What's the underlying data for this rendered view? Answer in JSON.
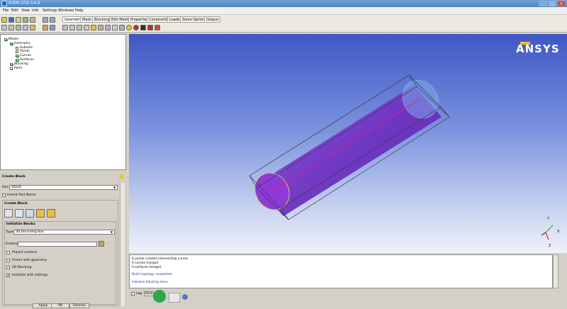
{
  "window": {
    "title": "ICEM CFD 14.0"
  },
  "menu": [
    "File",
    "Edit",
    "View",
    "Info",
    "Settings",
    "Windows",
    "Help"
  ],
  "tabs": [
    "Geometry",
    "Mesh",
    "Blocking",
    "Edit Mesh",
    "Properties",
    "Constraints",
    "Loads",
    "Solve Options",
    "Output"
  ],
  "tree": {
    "nodes": [
      {
        "label": "Model",
        "checked": true
      },
      {
        "label": "Geometry",
        "checked": true
      },
      {
        "label": "Subsets",
        "checked": false
      },
      {
        "label": "Points",
        "checked": false
      },
      {
        "label": "Curves",
        "checked": true
      },
      {
        "label": "Surfaces",
        "checked": true
      },
      {
        "label": "Blocking",
        "checked": true
      },
      {
        "label": "Parts",
        "checked": false
      }
    ]
  },
  "create_block": {
    "title": "Create Block",
    "part_label": "Part",
    "part_value": "SOLID",
    "inherit_label": "Inherit Part Name",
    "group_title": "Create Block",
    "init_title": "Initialize Blocks",
    "type_label": "Type",
    "type_value": "3D Bounding Box",
    "entities_label": "Entities",
    "options": [
      {
        "label": "Project vertices",
        "checked": false
      },
      {
        "label": "Orient with geometry",
        "checked": false
      },
      {
        "label": "2D Blocking",
        "checked": false
      },
      {
        "label": "Initialize with settings",
        "checked": true
      }
    ],
    "buttons": {
      "apply": "Apply",
      "ok": "OK",
      "dismiss": "Dismiss"
    }
  },
  "brand": {
    "logo": "ANSYS"
  },
  "messages": [
    "0 points created intersecting curves",
    "0 curves merged",
    "0 surfaces merged",
    "Build topology completed",
    "Initialize blocking done"
  ],
  "message_controls": {
    "log": "Log",
    "save": "Save"
  },
  "axes": {
    "y": "Y",
    "x": "X",
    "z": "Z"
  },
  "colors": {
    "viewport_top": "#3f57c6",
    "cylinder": "#7b35c9",
    "accent_line": "#e02080"
  }
}
